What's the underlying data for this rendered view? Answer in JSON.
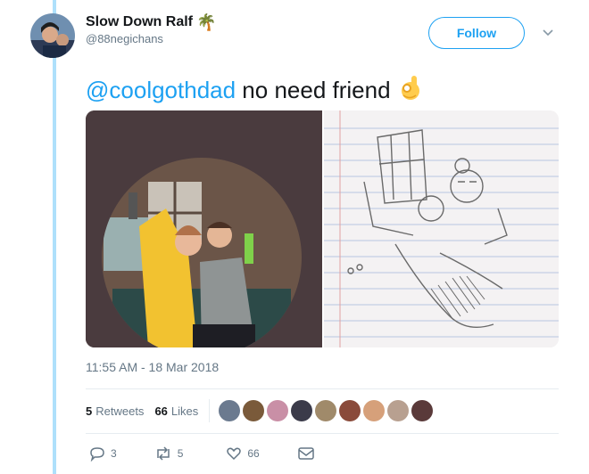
{
  "user": {
    "display_name": "Slow Down Ralf",
    "name_emoji": "🌴",
    "handle": "@88negichans"
  },
  "follow_label": "Follow",
  "tweet": {
    "mention": "@coolgothdad",
    "text": " no need friend",
    "emoji": "ok-hand-icon"
  },
  "timestamp": "11:55 AM - 18 Mar 2018",
  "stats": {
    "retweets_count": "5",
    "retweets_label": "Retweets",
    "likes_count": "66",
    "likes_label": "Likes"
  },
  "liker_avatars": [
    "#6b7a8f",
    "#7a5a3a",
    "#c98fa6",
    "#3b3b4a",
    "#a08a6a",
    "#8a4a3a",
    "#d6a07a",
    "#b8a090",
    "#5a3a3a"
  ],
  "actions": {
    "replies": "3",
    "retweets": "5",
    "likes": "66"
  },
  "colors": {
    "accent": "#1da1f2",
    "text": "#14171a",
    "muted": "#657786",
    "thread": "#aee0fb"
  }
}
